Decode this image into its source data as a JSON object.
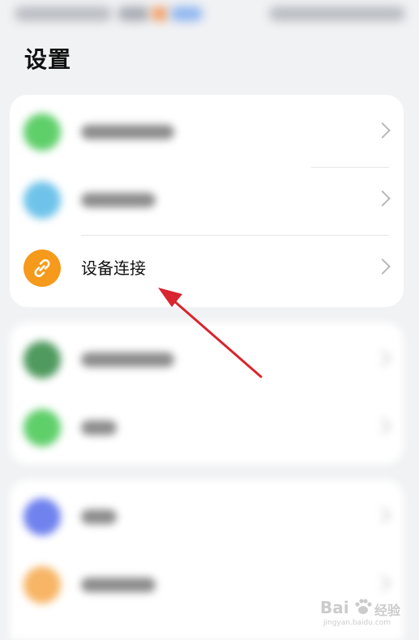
{
  "page": {
    "title": "设置"
  },
  "settings": {
    "device_connection": {
      "label": "设备连接"
    }
  },
  "colors": {
    "background": "#f1f2f4",
    "card": "#ffffff",
    "link_icon": "#f59a1b",
    "arrow": "#d8252f"
  },
  "icons": {
    "link": "link-icon",
    "chevron": "chevron-right-icon"
  },
  "watermark": {
    "brand": "Bai",
    "brand_suffix": "经验",
    "url": "jingyan.baidu.com"
  }
}
